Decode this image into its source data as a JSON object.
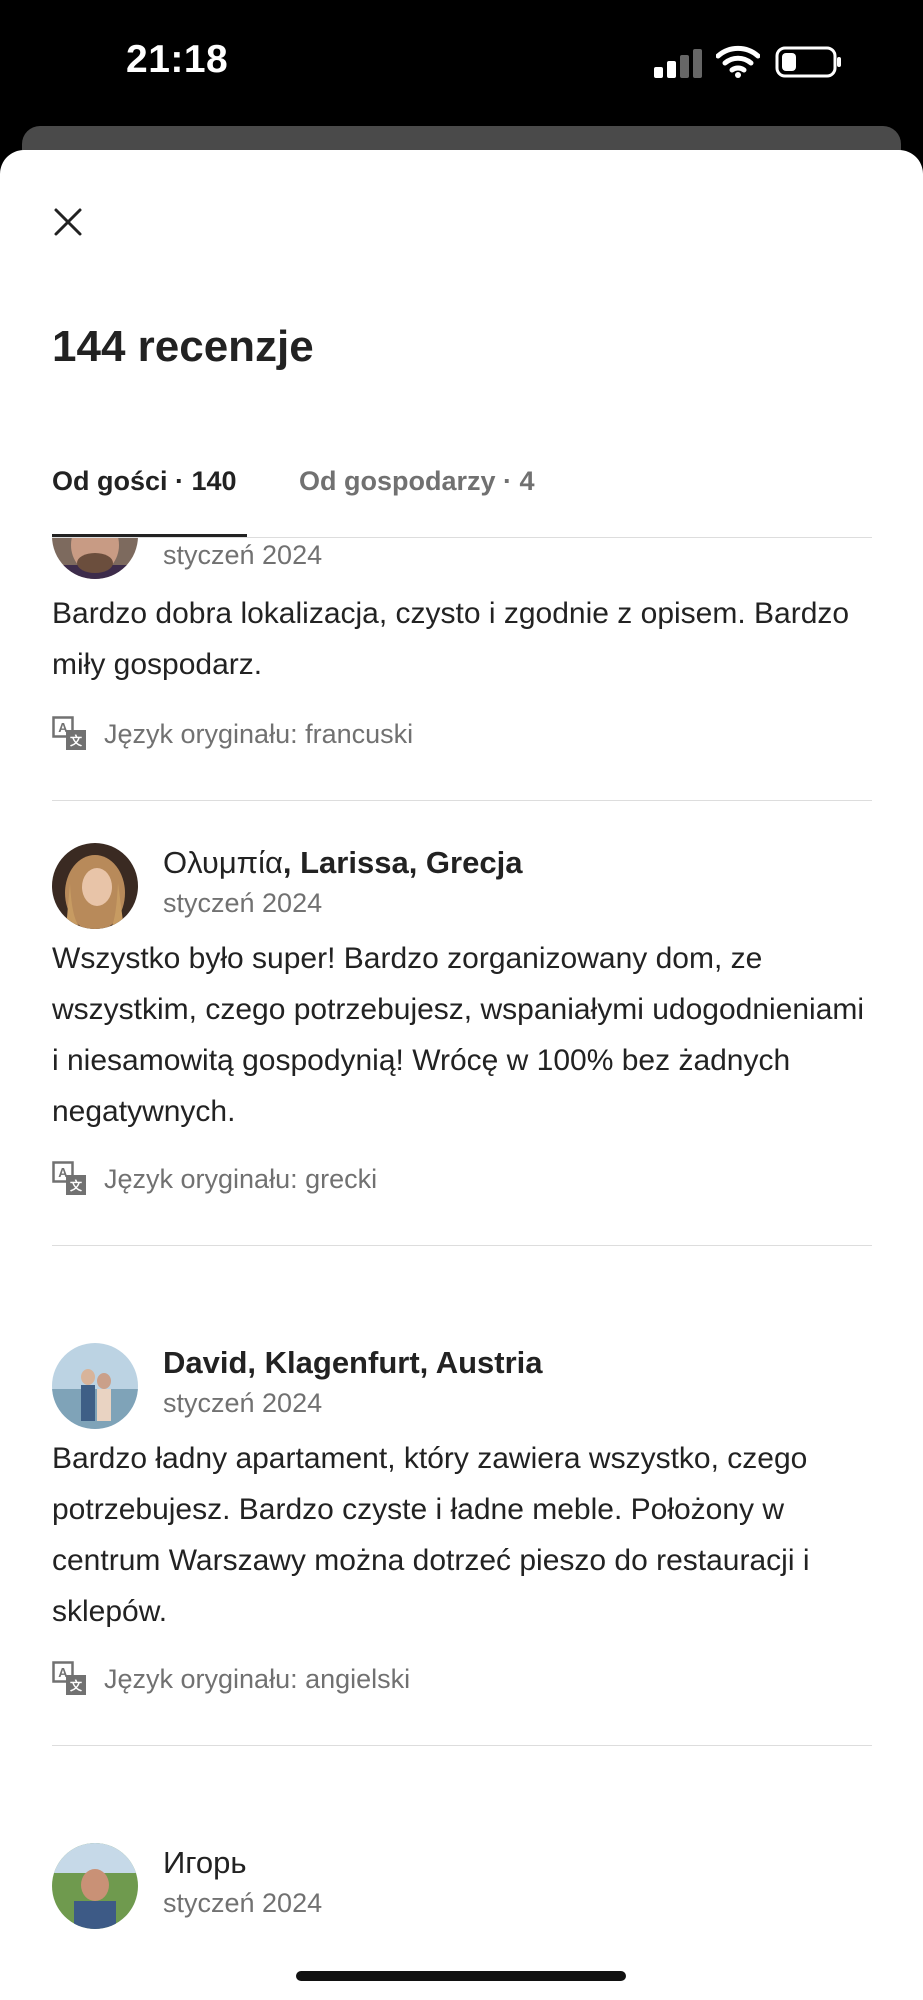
{
  "status_bar": {
    "time": "21:18"
  },
  "header": {
    "close_icon": "close-icon",
    "title": "144 recenzje"
  },
  "tabs": [
    {
      "label": "Od gości · 140",
      "active": true
    },
    {
      "label": "Od gospodarzy · 4",
      "active": false
    }
  ],
  "reviews": [
    {
      "name_part1": "",
      "name_part2": "",
      "date": "styczeń 2024",
      "text": "Bardzo dobra lokalizacja, czysto i zgodnie z opisem. Bardzo miły gospodarz.",
      "language": "Język oryginału: francuski"
    },
    {
      "name_part1": "Ολυμπία",
      "name_part2": ", Larissa, Grecja",
      "date": "styczeń 2024",
      "text": "Wszystko było super! Bardzo zorganizowany dom, ze wszystkim, czego potrzebujesz, wspaniałymi udogodnieniami i niesamowitą gospodynią! Wrócę w 100% bez żadnych negatywnych.",
      "language": "Język oryginału: grecki"
    },
    {
      "name_part1": "",
      "name_part2": "David, Klagenfurt, Austria",
      "date": "styczeń 2024",
      "text": "Bardzo ładny apartament, który zawiera wszystko, czego potrzebujesz. Bardzo czyste i ładne meble. Położony w centrum Warszawy można dotrzeć pieszo do restauracji i sklepów.",
      "language": "Język oryginału: angielski"
    },
    {
      "name_part1": "Игорь",
      "name_part2": "",
      "date": "styczeń 2024",
      "text": "",
      "language": ""
    }
  ],
  "icons": {
    "translate": "translate-icon",
    "signal": "cellular-signal-icon",
    "wifi": "wifi-icon",
    "battery": "battery-icon"
  },
  "colors": {
    "text_primary": "#222222",
    "text_secondary": "#717171",
    "divider": "#dddddd"
  }
}
